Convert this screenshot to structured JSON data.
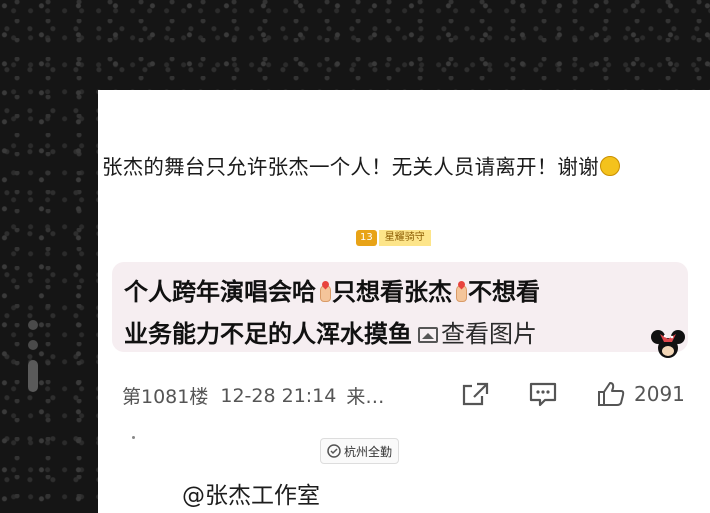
{
  "post": {
    "headline": "张杰的舞台只允许张杰一个人！无关人员请离开！谢谢",
    "user_level": {
      "number": "13",
      "badge_name": "星耀骑守"
    },
    "comment": {
      "line1_part1": "个人跨年演唱会哈",
      "line1_part2": "只想看张杰",
      "line1_part3": "不想看",
      "line2_text": "业务能力不足的人浑水摸鱼",
      "view_image_label": "查看图片"
    },
    "meta": {
      "floor": "第1081楼",
      "time": "12-28 21:14",
      "source_truncated": "来…"
    },
    "actions": {
      "like_count": "2091"
    },
    "location_tag": "杭州全勤",
    "watermark": "@张杰工作室"
  },
  "icons": {
    "headline_end": "smile-emoji-icon",
    "hand": "finger-heart-emoji-icon",
    "image": "image-icon",
    "share": "share-icon",
    "comment": "comment-icon",
    "like": "thumbs-up-icon",
    "location": "location-badge-icon",
    "sticker": "minnie-mouse-sticker"
  },
  "colors": {
    "bubble_bg": "#f6eef1",
    "badge_gold": "#e8a317",
    "badge_light": "#fde58a"
  }
}
